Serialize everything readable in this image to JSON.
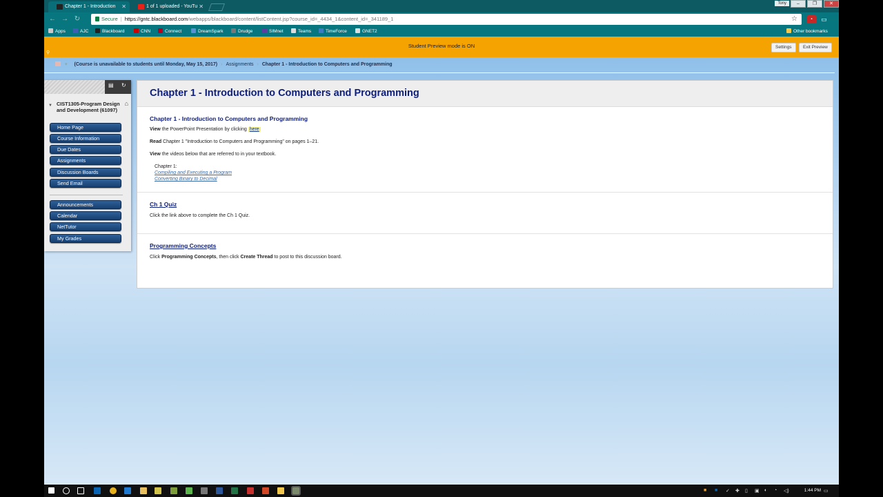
{
  "browser": {
    "tabs": [
      {
        "title": "Chapter 1 - Introduction"
      },
      {
        "title": "1 of 1 uploaded - YouTu"
      }
    ],
    "profile": "Tony",
    "window_controls": {
      "minimize": "–",
      "maximize": "❐",
      "close": "✕"
    },
    "secure_label": "Secure",
    "url_host": "https://gntc.blackboard.com",
    "url_path": "/webapps/blackboard/content/listContent.jsp?course_id=_4434_1&content_id=_341189_1"
  },
  "bookmarks": [
    {
      "label": "Apps",
      "color": "#c9c9c9"
    },
    {
      "label": "AJC",
      "color": "#3b5fb5"
    },
    {
      "label": "Blackboard",
      "color": "#222222"
    },
    {
      "label": "CNN",
      "color": "#cc0000"
    },
    {
      "label": "Connect",
      "color": "#b8001f"
    },
    {
      "label": "DreamSpark",
      "color": "#5a8fd6"
    },
    {
      "label": "Drudge",
      "color": "#777777"
    },
    {
      "label": "SIMnet",
      "color": "#5a3ea0"
    },
    {
      "label": "Teams",
      "color": "#dddddd"
    },
    {
      "label": "TimeForce",
      "color": "#3c7bbf"
    },
    {
      "label": "GNET2",
      "color": "#dddddd"
    }
  ],
  "other_bookmarks": "Other bookmarks",
  "preview": {
    "text": "Student Preview mode is ON",
    "settings": "Settings",
    "exit": "Exit Preview"
  },
  "breadcrumb": {
    "course": "(Course is unavailable to students until Monday, May 15, 2017)",
    "section": "Assignments",
    "current": "Chapter 1 - Introduction to Computers and Programming"
  },
  "course_menu": {
    "course_title": "CIST1305-Program Design and Development (61097)",
    "group1": [
      "Home Page",
      "Course Information",
      "Due Dates",
      "Assignments",
      "Discussion Boards",
      "Send Email"
    ],
    "group2": [
      "Announcements",
      "Calendar",
      "NetTutor",
      "My Grades"
    ]
  },
  "content": {
    "page_title": "Chapter 1 - Introduction to Computers and Programming",
    "item1": {
      "title": "Chapter 1 - Introduction to Computers and Programming",
      "view_bold": "View",
      "view_text": " the PowerPoint Presentation by clicking ",
      "here": "here",
      "read_bold": "Read",
      "read_text": " Chapter 1 \"Introduction to Computers and Programming\" on pages 1–21.",
      "view2_bold": "View",
      "view2_text": " the videos below that are referred to in your textbook.",
      "chapter_label": "Chapter 1:",
      "video1": "Compiling and Executing a Program",
      "video2": "Converting Binary to Decimal"
    },
    "item2": {
      "title": "Ch 1 Quiz",
      "text": "Click the link above to complete the Ch 1 Quiz."
    },
    "item3": {
      "title": "Programming Concepts",
      "p1": "Click ",
      "b1": "Programming Concepts",
      "p2": ", then click ",
      "b2": "Create Thread",
      "p3": " to post to this discussion board."
    }
  },
  "taskbar": {
    "clock": "1:44 PM"
  }
}
